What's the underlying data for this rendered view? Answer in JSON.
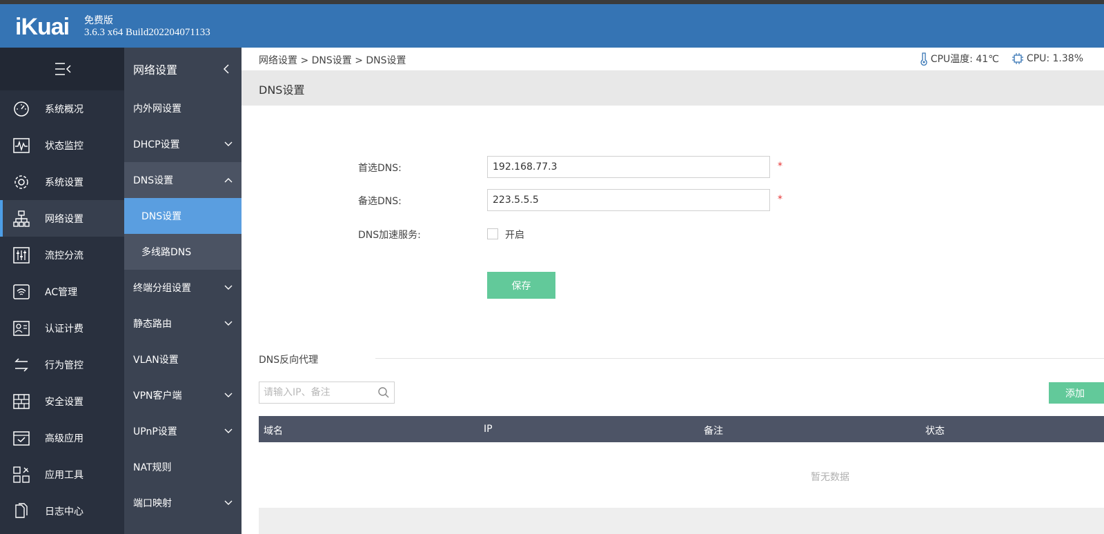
{
  "header": {
    "logo": "iKuai",
    "edition": "免费版",
    "version": "3.6.3 x64 Build202204071133"
  },
  "leftnav": {
    "items": [
      {
        "label": "系统概况",
        "icon": "dashboard-icon"
      },
      {
        "label": "状态监控",
        "icon": "monitor-icon"
      },
      {
        "label": "系统设置",
        "icon": "gear-icon"
      },
      {
        "label": "网络设置",
        "icon": "network-icon"
      },
      {
        "label": "流控分流",
        "icon": "sliders-icon"
      },
      {
        "label": "AC管理",
        "icon": "wifi-icon"
      },
      {
        "label": "认证计费",
        "icon": "id-card-icon"
      },
      {
        "label": "行为管控",
        "icon": "arrows-icon"
      },
      {
        "label": "安全设置",
        "icon": "firewall-icon"
      },
      {
        "label": "高级应用",
        "icon": "calendar-check-icon"
      },
      {
        "label": "应用工具",
        "icon": "tools-icon"
      },
      {
        "label": "日志中心",
        "icon": "document-icon"
      }
    ]
  },
  "subnav": {
    "title": "网络设置",
    "items": [
      {
        "label": "内外网设置"
      },
      {
        "label": "DHCP设置"
      },
      {
        "label": "DNS设置"
      },
      {
        "label": "DNS设置"
      },
      {
        "label": "多线路DNS"
      },
      {
        "label": "终端分组设置"
      },
      {
        "label": "静态路由"
      },
      {
        "label": "VLAN设置"
      },
      {
        "label": "VPN客户端"
      },
      {
        "label": "UPnP设置"
      },
      {
        "label": "NAT规则"
      },
      {
        "label": "端口映射"
      }
    ]
  },
  "topbar": {
    "breadcrumb": "网络设置 > DNS设置 > DNS设置",
    "cpu_temp": "CPU温度: 41℃",
    "cpu_usage": "CPU: 1.38%"
  },
  "page": {
    "title": "DNS设置"
  },
  "form": {
    "primary_label": "首选DNS:",
    "primary_value": "192.168.77.3",
    "secondary_label": "备选DNS:",
    "secondary_value": "223.5.5.5",
    "required_mark": "*",
    "accel_label": "DNS加速服务:",
    "accel_checkbox_label": "开启",
    "accel_enabled": false,
    "save_label": "保存"
  },
  "proxy": {
    "section_title": "DNS反向代理",
    "search_placeholder": "请输入IP、备注",
    "add_label": "添加",
    "columns": [
      "域名",
      "IP",
      "备注",
      "状态"
    ],
    "empty_text": "暂无数据"
  },
  "colors": {
    "header_bg": "#3574b4",
    "leftnav_bg": "#29303e",
    "subnav_bg": "#3b4352",
    "selected_bg": "#5a9ee0",
    "button_green": "#62c99a",
    "table_head_bg": "#4d5466"
  }
}
